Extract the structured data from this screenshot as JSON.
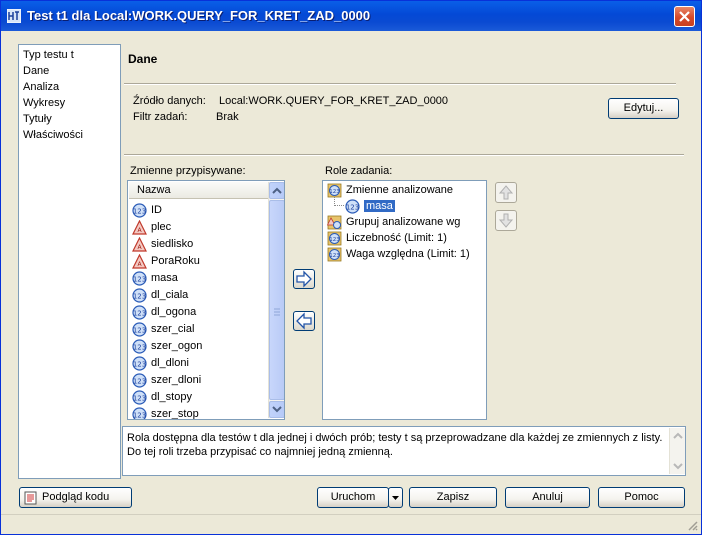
{
  "window": {
    "title": "Test t1 dla Local:WORK.QUERY_FOR_KRET_ZAD_0000"
  },
  "nav": {
    "items": [
      "Typ testu t",
      "Dane",
      "Analiza",
      "Wykresy",
      "Tytuły",
      "Właściwości"
    ],
    "selected_index": 1
  },
  "section": {
    "title": "Dane"
  },
  "source": {
    "label": "Źródło danych:",
    "value": "Local:WORK.QUERY_FOR_KRET_ZAD_0000",
    "filter_label": "Filtr zadań:",
    "filter_value": "Brak",
    "edit_button": "Edytuj..."
  },
  "variables": {
    "label": "Zmienne przypisywane:",
    "column_header": "Nazwa",
    "items": [
      {
        "name": "ID",
        "type": "numeric"
      },
      {
        "name": "plec",
        "type": "character"
      },
      {
        "name": "siedlisko",
        "type": "character"
      },
      {
        "name": "PoraRoku",
        "type": "character"
      },
      {
        "name": "masa",
        "type": "numeric"
      },
      {
        "name": "dl_ciala",
        "type": "numeric"
      },
      {
        "name": "dl_ogona",
        "type": "numeric"
      },
      {
        "name": "szer_cial",
        "type": "numeric"
      },
      {
        "name": "szer_ogon",
        "type": "numeric"
      },
      {
        "name": "dl_dloni",
        "type": "numeric"
      },
      {
        "name": "szer_dloni",
        "type": "numeric"
      },
      {
        "name": "dl_stopy",
        "type": "numeric"
      },
      {
        "name": "szer_stop",
        "type": "numeric"
      }
    ]
  },
  "roles": {
    "label": "Role zadania:",
    "items": [
      {
        "name": "Zmienne analizowane",
        "level": 0,
        "icon": "role-numeric-icon"
      },
      {
        "name": "masa",
        "level": 1,
        "icon": "numeric-variable-icon",
        "selected": true
      },
      {
        "name": "Grupuj analizowane wg",
        "level": 0,
        "icon": "role-group-icon"
      },
      {
        "name": "Liczebność  (Limit: 1)",
        "level": 0,
        "icon": "role-numeric-icon"
      },
      {
        "name": "Waga względna  (Limit: 1)",
        "level": 0,
        "icon": "role-numeric-icon"
      }
    ]
  },
  "description": "Rola dostępna dla testów t dla jednej i dwóch prób; testy t są przeprowadzane dla każdej ze zmiennych z listy. Do tej roli trzeba przypisać co najmniej jedną zmienną.",
  "footer": {
    "preview_code": "Podgląd kodu",
    "run": "Uruchom",
    "save": "Zapisz",
    "cancel": "Anuluj",
    "help": "Pomoc"
  },
  "colors": {
    "title_bar": "#0449d6",
    "selection": "#316ac5",
    "dialog_bg": "#ece9d8"
  }
}
